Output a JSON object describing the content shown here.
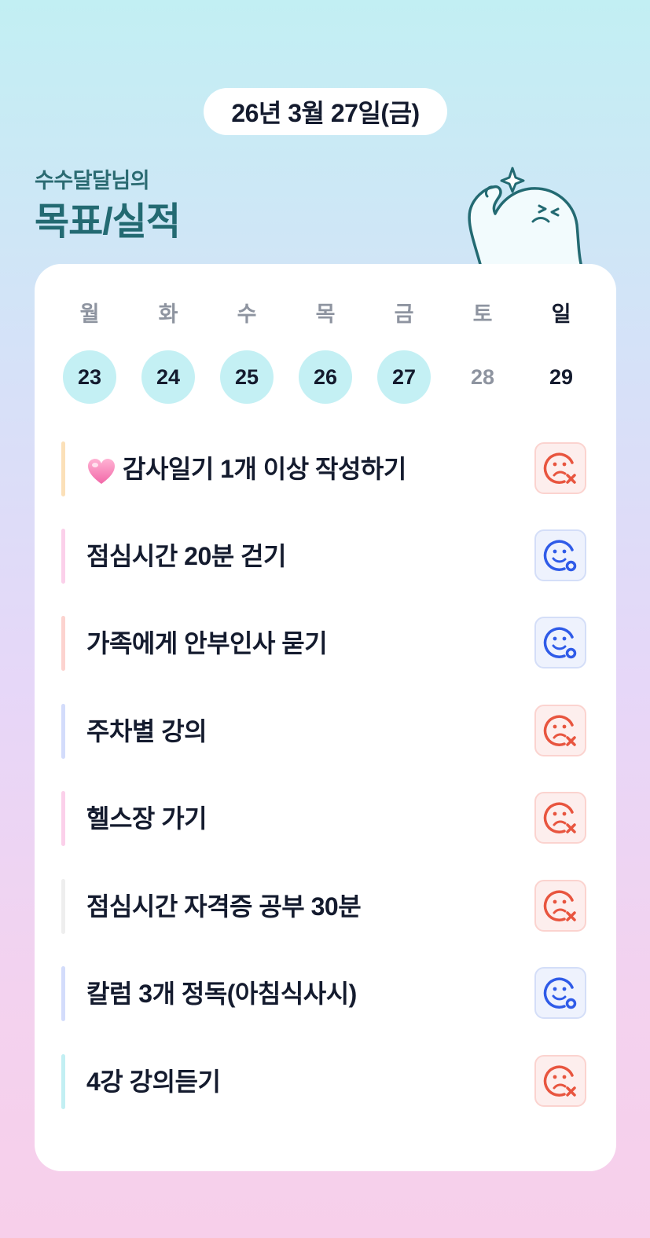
{
  "header": {
    "date": "26년 3월 27일(금)",
    "subtitle": "수수달달님의",
    "title": "목표/실적"
  },
  "week": {
    "days": [
      {
        "name": "월",
        "num": "23",
        "state": "active"
      },
      {
        "name": "화",
        "num": "24",
        "state": "active"
      },
      {
        "name": "수",
        "num": "25",
        "state": "active"
      },
      {
        "name": "목",
        "num": "26",
        "state": "active"
      },
      {
        "name": "금",
        "num": "27",
        "state": "active"
      },
      {
        "name": "토",
        "num": "28",
        "state": "future"
      },
      {
        "name": "일",
        "num": "29",
        "state": "sunday"
      }
    ]
  },
  "goals": [
    {
      "text": "감사일기 1개 이상 작성하기",
      "icon": "heart-icon",
      "status": "fail",
      "bar_color": "#fbe0b8"
    },
    {
      "text": "점심시간 20분 걷기",
      "status": "success",
      "bar_color": "#fbd0ea"
    },
    {
      "text": "가족에게 안부인사 묻기",
      "status": "success",
      "bar_color": "#fcd3cf"
    },
    {
      "text": "주차별 강의",
      "status": "fail",
      "bar_color": "#d3dcfb"
    },
    {
      "text": "헬스장 가기",
      "status": "fail",
      "bar_color": "#fbd0ea"
    },
    {
      "text": "점심시간 자격증 공부 30분",
      "status": "fail",
      "bar_color": "#eeeeee"
    },
    {
      "text": "칼럼 3개 정독(아침식사시)",
      "status": "success",
      "bar_color": "#d3dcfb"
    },
    {
      "text": "4강 강의듣기",
      "status": "fail",
      "bar_color": "#c2eff3"
    }
  ],
  "colors": {
    "accent": "#236a72",
    "active_day": "#c4f0f4",
    "fail": "#e8553f",
    "success": "#2f5be8"
  }
}
